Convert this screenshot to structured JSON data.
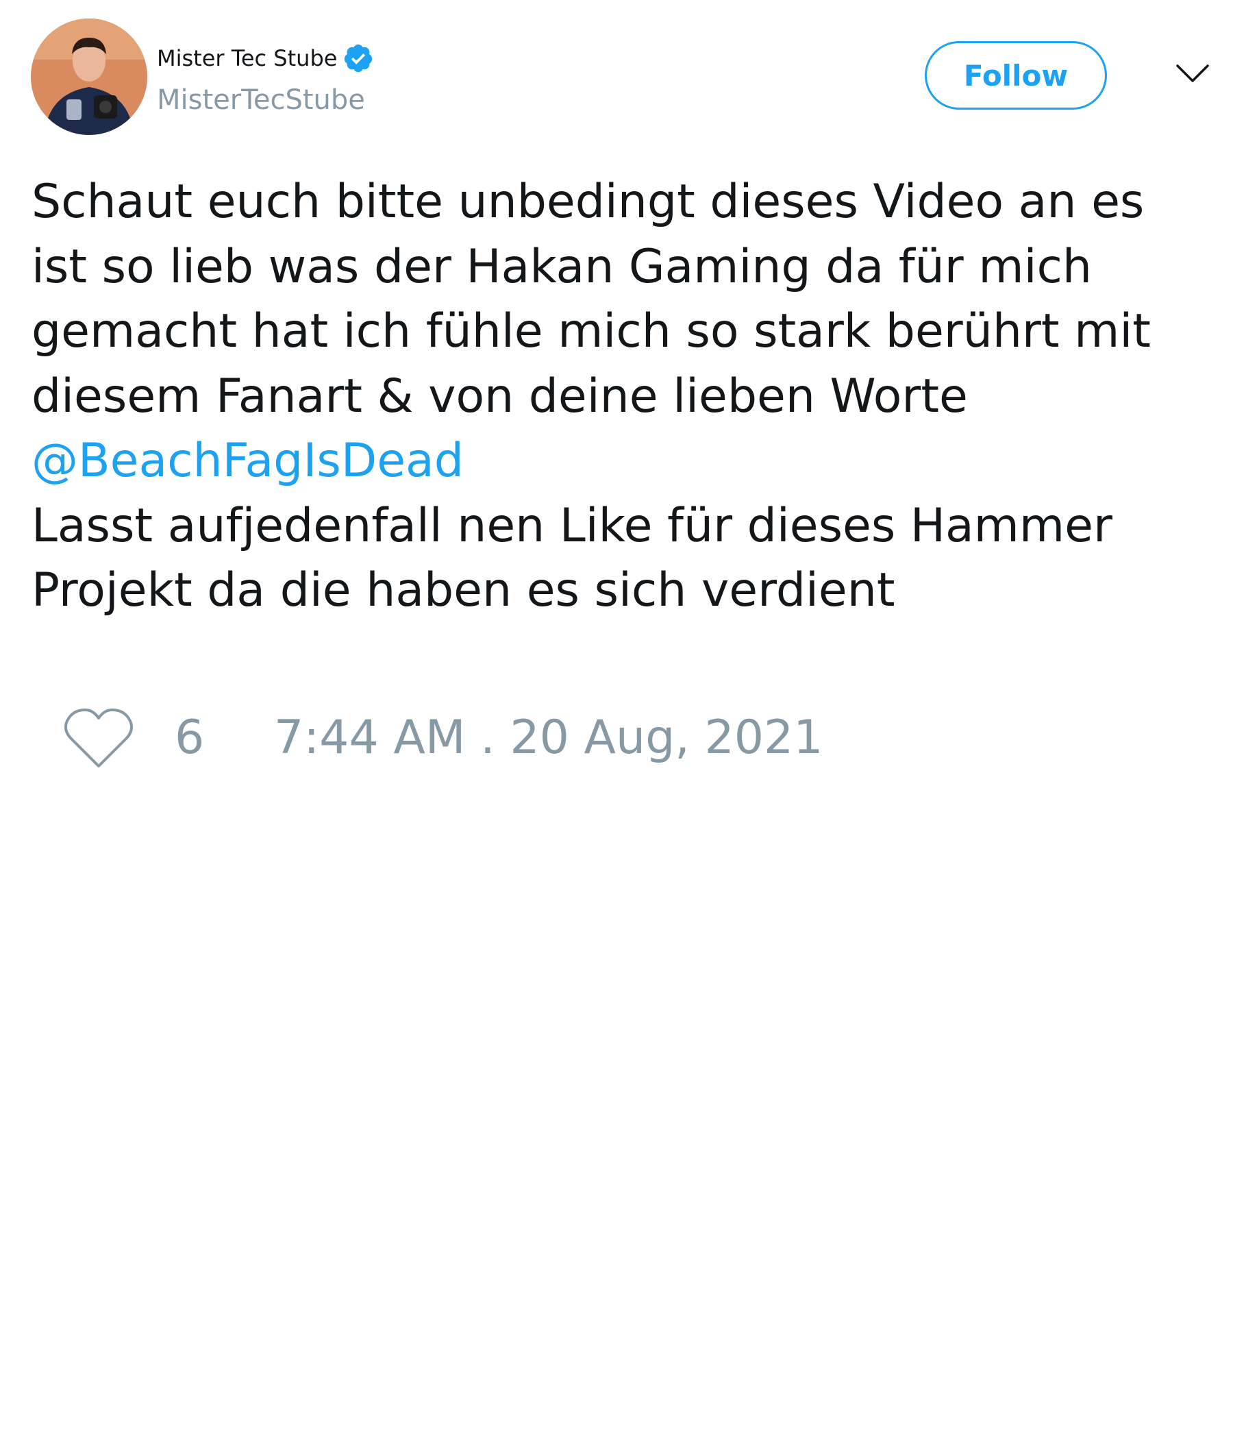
{
  "author": {
    "display_name": "Mister Tec Stube",
    "handle": "MisterTecStube",
    "verified": true
  },
  "actions": {
    "follow_label": "Follow"
  },
  "tweet": {
    "text_part1": "Schaut euch bitte unbedingt dieses Video an es ist so lieb was der Hakan Gaming da für mich gemacht hat ich fühle mich so stark berührt mit diesem Fanart & von deine lieben Worte",
    "mention": "@BeachFagIsDead",
    "text_part2": "Lasst aufjedenfall nen Like für dieses Hammer Projekt da die haben es sich verdient"
  },
  "stats": {
    "likes": "6",
    "timestamp": "7:44 AM . 20 Aug, 2021"
  },
  "colors": {
    "accent": "#1da1f2",
    "text": "#14171a",
    "muted": "#8899a6",
    "background": "#ffffff"
  },
  "icons": {
    "verified": "verified-badge-icon",
    "menu": "chevron-down-icon",
    "like": "heart-icon"
  }
}
